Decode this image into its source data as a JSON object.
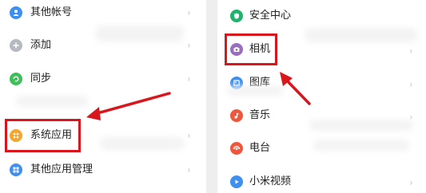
{
  "left_panel": {
    "items": [
      {
        "label": "其他帐号",
        "icon": "person-icon",
        "color": "#3d8ff0"
      },
      {
        "label": "添加",
        "icon": "plus-icon",
        "color": "#b5b9c0"
      },
      {
        "label": "同步",
        "icon": "sync-icon",
        "color": "#3fbf59"
      },
      {
        "label": "系统应用",
        "icon": "apps-grid-icon",
        "color": "#f5a52a"
      },
      {
        "label": "其他应用管理",
        "icon": "app-manage-icon",
        "color": "#3d8ff0"
      }
    ]
  },
  "right_panel": {
    "items": [
      {
        "label": "安全中心",
        "icon": "shield-icon",
        "color": "#20b36b"
      },
      {
        "label": "相机",
        "icon": "camera-icon",
        "color": "#9b6fc0"
      },
      {
        "label": "图库",
        "icon": "gallery-icon",
        "color": "#3d8ff0"
      },
      {
        "label": "音乐",
        "icon": "music-icon",
        "color": "#f0563c"
      },
      {
        "label": "电台",
        "icon": "radio-icon",
        "color": "#f0563c"
      },
      {
        "label": "小米视频",
        "icon": "play-icon",
        "color": "#3d8ff0"
      }
    ]
  },
  "colors": {
    "highlight": "#d9161b",
    "chevron": "#b8b8b8"
  }
}
